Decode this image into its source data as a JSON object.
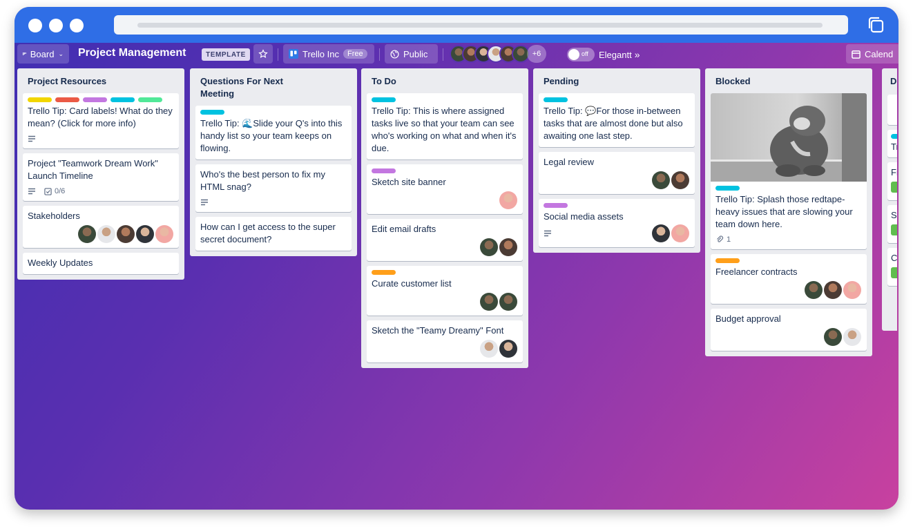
{
  "board": {
    "view_label": "Board",
    "title": "Project Management",
    "template_badge": "TEMPLATE",
    "workspace": "Trello Inc",
    "workspace_plan": "Free",
    "visibility": "Public",
    "more_members": "+6",
    "toggle_state": "off",
    "powerup": "Elegantt",
    "calendar": "Calend"
  },
  "colors": {
    "yellow": "#f2d600",
    "red": "#eb5a46",
    "purple": "#c377e0",
    "sky": "#00c2e0",
    "lime": "#51e898",
    "orange": "#ff9f1a",
    "green": "#61bd4f"
  },
  "lists": [
    {
      "title": "Project Resources",
      "cards": [
        {
          "text": "Trello Tip: Card labels! What do they mean? (Click for more info)"
        },
        {
          "text": "Project \"Teamwork Dream Work\" Launch Timeline",
          "checklist": "0/6"
        },
        {
          "text": "Stakeholders"
        },
        {
          "text": "Weekly Updates"
        }
      ]
    },
    {
      "title": "Questions For Next Meeting",
      "cards": [
        {
          "text": "Trello Tip: 🌊Slide your Q's into this handy list so your team keeps on flowing."
        },
        {
          "text": "Who's the best person to fix my HTML snag?"
        },
        {
          "text": "How can I get access to the super secret document?"
        }
      ]
    },
    {
      "title": "To Do",
      "cards": [
        {
          "text": "Trello Tip: This is where assigned tasks live so that your team can see who's working on what and when it's due."
        },
        {
          "text": "Sketch site banner"
        },
        {
          "text": "Edit email drafts"
        },
        {
          "text": "Curate customer list"
        },
        {
          "text": "Sketch the \"Teamy Dreamy\" Font"
        }
      ]
    },
    {
      "title": "Pending",
      "cards": [
        {
          "text": "Trello Tip: 💬For those in-between tasks that are almost done but also awaiting one last step."
        },
        {
          "text": "Legal review"
        },
        {
          "text": "Social media assets"
        }
      ]
    },
    {
      "title": "Blocked",
      "cards": [
        {
          "text": "Trello Tip: Splash those redtape-heavy issues that are slowing your team down here.",
          "attachments": "1"
        },
        {
          "text": "Freelancer contracts"
        },
        {
          "text": "Budget approval"
        }
      ]
    },
    {
      "title": "Do",
      "cards": [
        {
          "text": "Tre For tea"
        },
        {
          "text": "Fin Dre"
        },
        {
          "text": "Sul"
        },
        {
          "text": "Ca"
        }
      ]
    }
  ]
}
